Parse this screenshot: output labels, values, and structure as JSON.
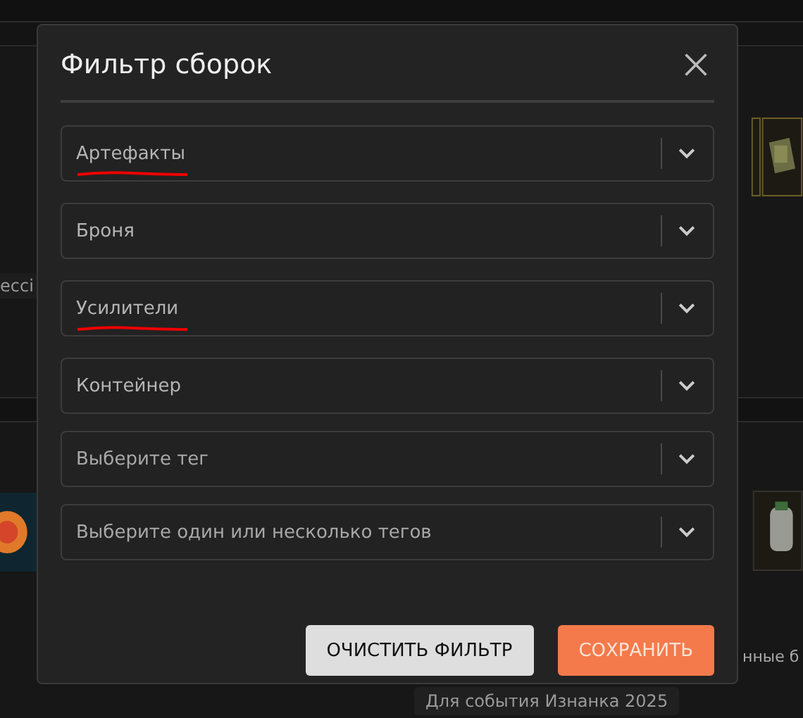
{
  "background": {
    "texts": [
      "ессі",
      "нные б",
      "Для события Изнанка 2025"
    ]
  },
  "dialog": {
    "title": "Фильтр сборок",
    "selects": [
      {
        "value": "Артефакты",
        "annotated": true
      },
      {
        "value": "Броня",
        "annotated": false
      },
      {
        "value": "Усилители",
        "annotated": true
      },
      {
        "value": "Контейнер",
        "annotated": false
      },
      {
        "placeholder": "Выберите тег",
        "annotated": false
      },
      {
        "placeholder": "Выберите один или несколько тегов",
        "annotated": false
      }
    ],
    "buttons": [
      {
        "label": "ОЧИСТИТЬ ФИЛЬТР",
        "kind": "secondary"
      },
      {
        "label": "СОХРАНИТЬ",
        "kind": "primary"
      }
    ]
  }
}
